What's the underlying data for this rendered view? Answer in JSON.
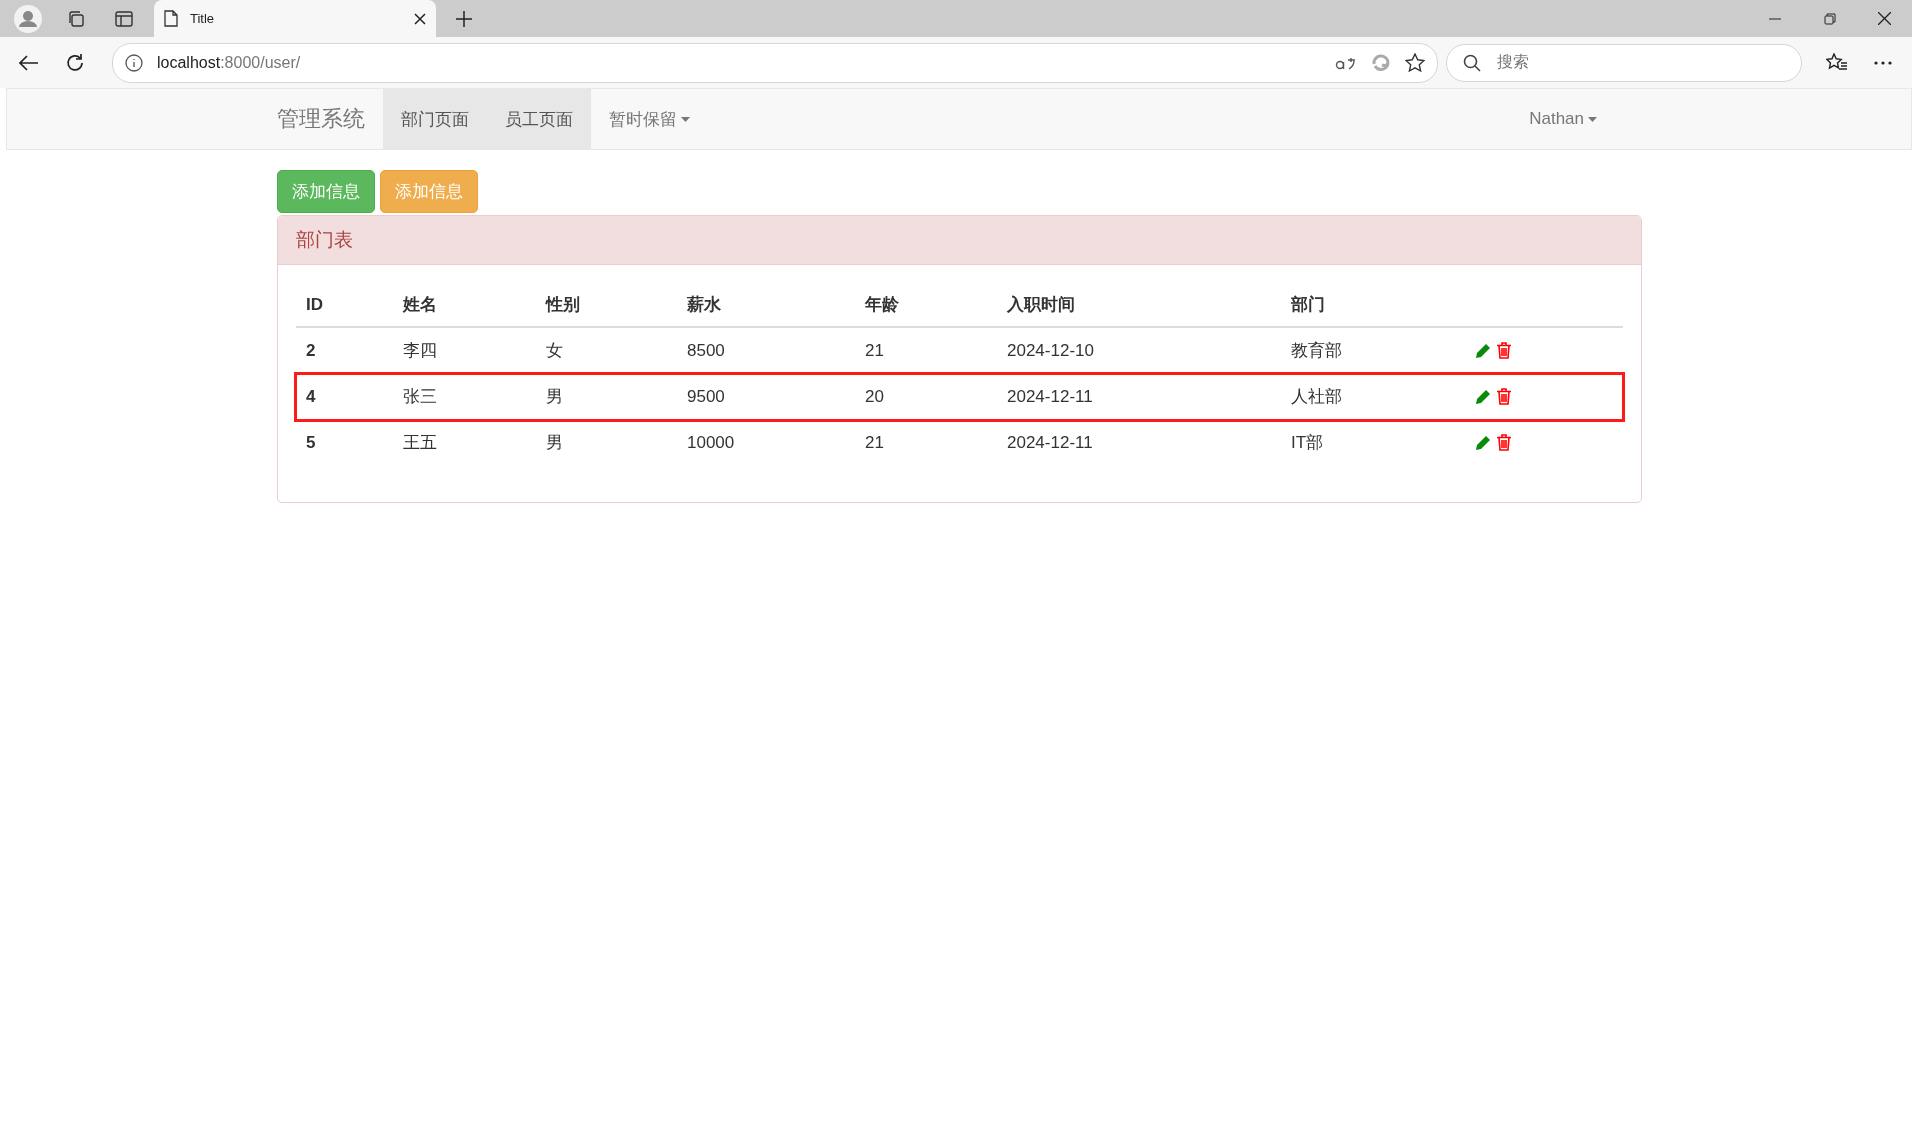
{
  "browser": {
    "tab_title": "Title",
    "url_host": "localhost",
    "url_path": ":8000/user/",
    "search_placeholder": "搜索"
  },
  "navbar": {
    "brand": "管理系统",
    "items": [
      {
        "label": "部门页面",
        "selected": true,
        "dropdown": false
      },
      {
        "label": "员工页面",
        "selected": true,
        "dropdown": false
      },
      {
        "label": "暂时保留",
        "selected": false,
        "dropdown": true
      }
    ],
    "user": {
      "label": "Nathan",
      "dropdown": true
    }
  },
  "buttons": [
    {
      "label": "添加信息",
      "kind": "success"
    },
    {
      "label": "添加信息",
      "kind": "warning"
    }
  ],
  "panel": {
    "title": "部门表",
    "table": {
      "columns": [
        "ID",
        "姓名",
        "性别",
        "薪水",
        "年龄",
        "入职时间",
        "部门"
      ],
      "rows": [
        {
          "cells": [
            "2",
            "李四",
            "女",
            "8500",
            "21",
            "2024-12-10",
            "教育部"
          ],
          "highlighted": false
        },
        {
          "cells": [
            "4",
            "张三",
            "男",
            "9500",
            "20",
            "2024-12-11",
            "人社部"
          ],
          "highlighted": true
        },
        {
          "cells": [
            "5",
            "王五",
            "男",
            "10000",
            "21",
            "2024-12-11",
            "IT部"
          ],
          "highlighted": false
        }
      ]
    }
  }
}
